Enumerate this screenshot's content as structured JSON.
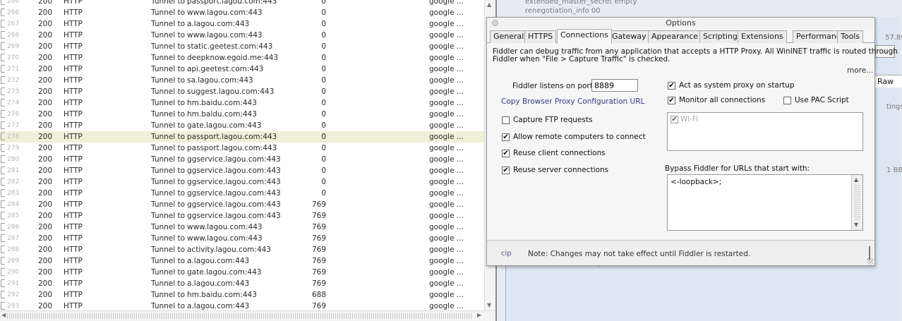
{
  "sessions": [
    {
      "num": "266",
      "result": "200",
      "protocol": "HTTP",
      "host": "Tunnel to",
      "url": "passport.lagou.com:443",
      "body": "0",
      "process": "google ...",
      "selected": false
    },
    {
      "num": "266",
      "result": "200",
      "protocol": "HTTP",
      "host": "Tunnel to",
      "url": "www.lagou.com:443",
      "body": "0",
      "process": "google ...",
      "selected": false
    },
    {
      "num": "267",
      "result": "200",
      "protocol": "HTTP",
      "host": "Tunnel to",
      "url": "a.lagou.com:443",
      "body": "0",
      "process": "google ...",
      "selected": false
    },
    {
      "num": "268",
      "result": "200",
      "protocol": "HTTP",
      "host": "Tunnel to",
      "url": "www.lagou.com:443",
      "body": "0",
      "process": "google ...",
      "selected": false
    },
    {
      "num": "269",
      "result": "200",
      "protocol": "HTTP",
      "host": "Tunnel to",
      "url": "static.geetest.com:443",
      "body": "0",
      "process": "google ...",
      "selected": false
    },
    {
      "num": "270",
      "result": "200",
      "protocol": "HTTP",
      "host": "Tunnel to",
      "url": "deepknow.egoid.me:443",
      "body": "0",
      "process": "google ...",
      "selected": false
    },
    {
      "num": "271",
      "result": "200",
      "protocol": "HTTP",
      "host": "Tunnel to",
      "url": "api.geetest.com:443",
      "body": "0",
      "process": "google ...",
      "selected": false
    },
    {
      "num": "272",
      "result": "200",
      "protocol": "HTTP",
      "host": "Tunnel to",
      "url": "sa.lagou.com:443",
      "body": "0",
      "process": "google ...",
      "selected": false
    },
    {
      "num": "273",
      "result": "200",
      "protocol": "HTTP",
      "host": "Tunnel to",
      "url": "suggest.lagou.com:443",
      "body": "0",
      "process": "google ...",
      "selected": false
    },
    {
      "num": "274",
      "result": "200",
      "protocol": "HTTP",
      "host": "Tunnel to",
      "url": "hm.baidu.com:443",
      "body": "0",
      "process": "google ...",
      "selected": false
    },
    {
      "num": "276",
      "result": "200",
      "protocol": "HTTP",
      "host": "Tunnel to",
      "url": "hm.baidu.com:443",
      "body": "0",
      "process": "google ...",
      "selected": false
    },
    {
      "num": "277",
      "result": "200",
      "protocol": "HTTP",
      "host": "Tunnel to",
      "url": "gate.lagou.com:443",
      "body": "0",
      "process": "google ...",
      "selected": false
    },
    {
      "num": "278",
      "result": "200",
      "protocol": "HTTP",
      "host": "Tunnel to",
      "url": "passport.lagou.com:443",
      "body": "0",
      "process": "google ...",
      "selected": true
    },
    {
      "num": "279",
      "result": "200",
      "protocol": "HTTP",
      "host": "Tunnel to",
      "url": "passport.lagou.com:443",
      "body": "0",
      "process": "google ...",
      "selected": false
    },
    {
      "num": "280",
      "result": "200",
      "protocol": "HTTP",
      "host": "Tunnel to",
      "url": "ggservice.lagou.com:443",
      "body": "0",
      "process": "google ...",
      "selected": false
    },
    {
      "num": "281",
      "result": "200",
      "protocol": "HTTP",
      "host": "Tunnel to",
      "url": "ggservice.lagou.com:443",
      "body": "0",
      "process": "google ...",
      "selected": false
    },
    {
      "num": "282",
      "result": "200",
      "protocol": "HTTP",
      "host": "Tunnel to",
      "url": "ggservice.lagou.com:443",
      "body": "0",
      "process": "google ...",
      "selected": false
    },
    {
      "num": "283",
      "result": "200",
      "protocol": "HTTP",
      "host": "Tunnel to",
      "url": "ggservice.lagou.com:443",
      "body": "0",
      "process": "google ...",
      "selected": false
    },
    {
      "num": "284",
      "result": "200",
      "protocol": "HTTP",
      "host": "Tunnel to",
      "url": "ggservice.lagou.com:443",
      "body": "769",
      "process": "google ...",
      "selected": false
    },
    {
      "num": "285",
      "result": "200",
      "protocol": "HTTP",
      "host": "Tunnel to",
      "url": "ggservice.lagou.com:443",
      "body": "769",
      "process": "google ...",
      "selected": false
    },
    {
      "num": "286",
      "result": "200",
      "protocol": "HTTP",
      "host": "Tunnel to",
      "url": "www.lagou.com:443",
      "body": "769",
      "process": "google ...",
      "selected": false
    },
    {
      "num": "287",
      "result": "200",
      "protocol": "HTTP",
      "host": "Tunnel to",
      "url": "www.lagou.com:443",
      "body": "769",
      "process": "google ...",
      "selected": false
    },
    {
      "num": "288",
      "result": "200",
      "protocol": "HTTP",
      "host": "Tunnel to",
      "url": "activity.lagou.com:443",
      "body": "769",
      "process": "google ...",
      "selected": false
    },
    {
      "num": "289",
      "result": "200",
      "protocol": "HTTP",
      "host": "Tunnel to",
      "url": "a.lagou.com:443",
      "body": "769",
      "process": "google ...",
      "selected": false
    },
    {
      "num": "290",
      "result": "200",
      "protocol": "HTTP",
      "host": "Tunnel to",
      "url": "gate.lagou.com:443",
      "body": "769",
      "process": "google ...",
      "selected": false
    },
    {
      "num": "291",
      "result": "200",
      "protocol": "HTTP",
      "host": "Tunnel to",
      "url": "a.lagou.com:443",
      "body": "769",
      "process": "google ...",
      "selected": false
    },
    {
      "num": "292",
      "result": "200",
      "protocol": "HTTP",
      "host": "Tunnel to",
      "url": "hm.baidu.com:443",
      "body": "688",
      "process": "google ...",
      "selected": false
    },
    {
      "num": "293",
      "result": "200",
      "protocol": "HTTP",
      "host": "Tunnel to",
      "url": "a.lagou.com:443",
      "body": "769",
      "process": "google ...",
      "selected": false
    }
  ],
  "right_panel": {
    "line1": "extended_master_secret        empty",
    "line2": "renegotiation_info       00",
    "num_fragment": "57.89",
    "dots_button": "...",
    "raw_tab": "Raw",
    "settings_fragment": "tings",
    "size_fragment": "1 BB",
    "note_fragment": "http..."
  },
  "dialog": {
    "title": "Options",
    "tabs": [
      "General",
      "HTTPS",
      "Connections",
      "Gateway",
      "Appearance",
      "Scripting",
      "Extensions",
      "Performance",
      "Tools"
    ],
    "active_tab": "Connections",
    "description": "Fiddler can debug traffic from any application that accepts a HTTP Proxy. All WinINET traffic is routed through",
    "description2": "Fiddler when \"File > Capture Traffic\" is checked.",
    "more_link": "more...",
    "port_label": "Fiddler listens on port:",
    "port_value": "8889",
    "copy_link": "Copy Browser Proxy Configuration URL",
    "capture_ftp": {
      "label": "Capture FTP requests",
      "checked": false
    },
    "allow_remote": {
      "label": "Allow remote computers to connect",
      "checked": true
    },
    "reuse_client": {
      "label": "Reuse client connections",
      "checked": true
    },
    "reuse_server": {
      "label": "Reuse server connections",
      "checked": true
    },
    "act_as_proxy": {
      "label": "Act as system proxy on startup",
      "checked": true
    },
    "monitor_all": {
      "label": "Monitor all connections",
      "checked": true
    },
    "use_pac": {
      "label": "Use PAC Script",
      "checked": false
    },
    "connection_item": {
      "label": "Wi-Fi",
      "checked": true
    },
    "bypass_label": "Bypass Fiddler for URLs that start with:",
    "bypass_value": "<-loopback>;",
    "footer_fragment": "cip",
    "footer_note": "Note: Changes may not take effect until Fiddler is restarted."
  }
}
